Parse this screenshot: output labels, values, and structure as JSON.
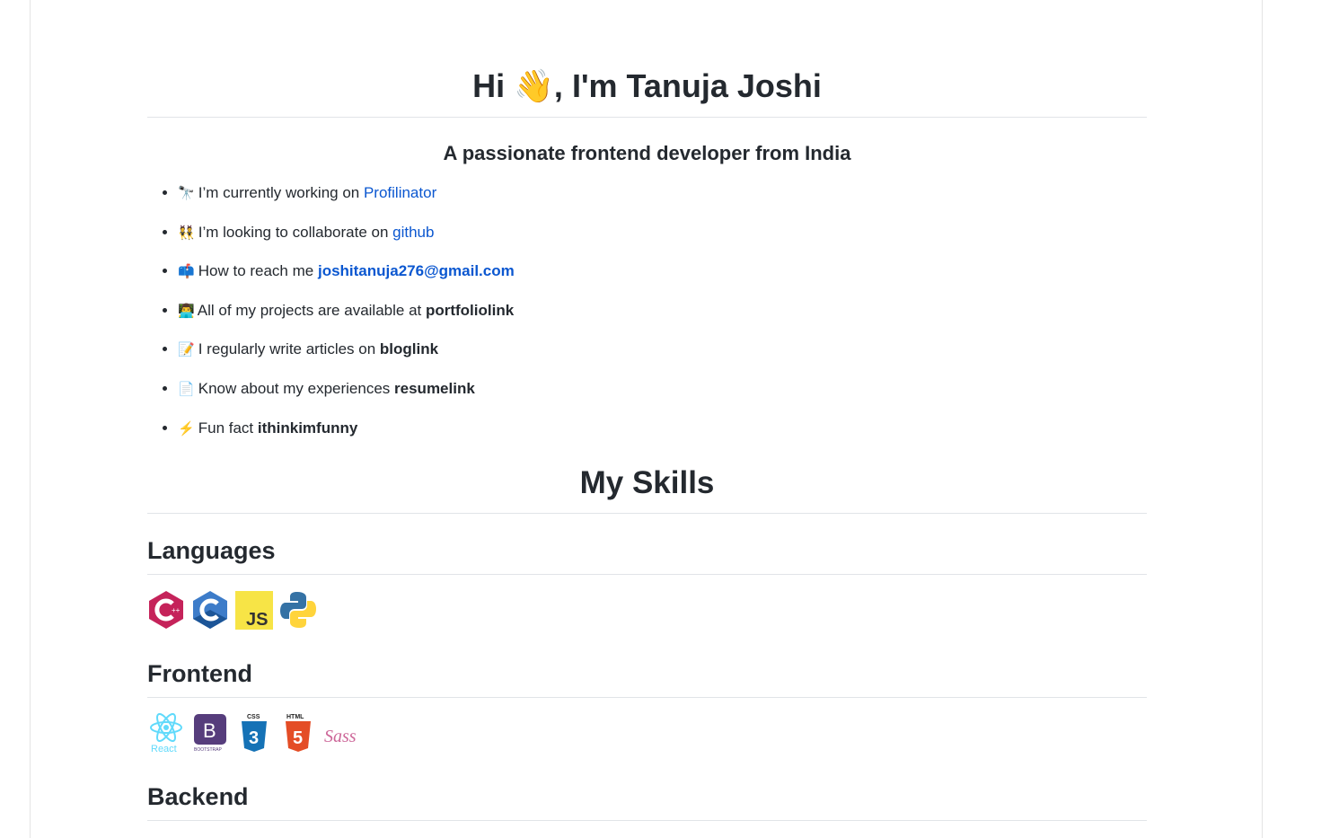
{
  "header": {
    "title": "Hi 👋, I'm Tanuja Joshi",
    "subtitle": "A passionate frontend developer from India"
  },
  "about": [
    {
      "emoji": "🔭",
      "text": "I’m currently working on ",
      "link": "Profilinator"
    },
    {
      "emoji": "👯",
      "text": "I’m looking to collaborate on ",
      "link": "github"
    },
    {
      "emoji": "📫",
      "text": "How to reach me ",
      "link": "joshitanuja276@gmail.com"
    },
    {
      "emoji": "👨‍💻",
      "text": "All of my projects are available at ",
      "bold": "portfoliolink"
    },
    {
      "emoji": "📝",
      "text": "I regularly write articles on ",
      "bold": "bloglink"
    },
    {
      "emoji": "📄",
      "text": "Know about my experiences ",
      "bold": "resumelink"
    },
    {
      "emoji": "⚡",
      "text": "Fun fact ",
      "bold": "ithinkimfunny"
    }
  ],
  "skills": {
    "title": "My Skills",
    "languages": "Languages",
    "frontend": "Frontend",
    "backend": "Backend",
    "language_icons": [
      "cplusplus",
      "c",
      "javascript",
      "python"
    ],
    "frontend_icons": [
      "react",
      "bootstrap",
      "css3",
      "html5",
      "sass"
    ],
    "icon_text": {
      "js": "JS",
      "react": "React",
      "bootstrap": "B",
      "bootstrap_small": "BOOTSTRAP",
      "css": "CSS",
      "html": "HTML",
      "sass": "Sass"
    }
  }
}
